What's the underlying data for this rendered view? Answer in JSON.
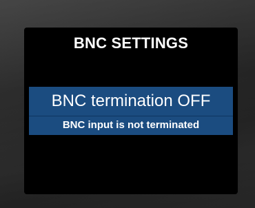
{
  "screen": {
    "title": "BNC SETTINGS",
    "selected_setting": {
      "value_label": "BNC termination OFF",
      "description": "BNC input is not terminated"
    }
  },
  "colors": {
    "screen_background": "#000000",
    "highlight_panel": "#1b4c80",
    "text": "#ffffff",
    "device_bezel": "#2b2b2b"
  }
}
